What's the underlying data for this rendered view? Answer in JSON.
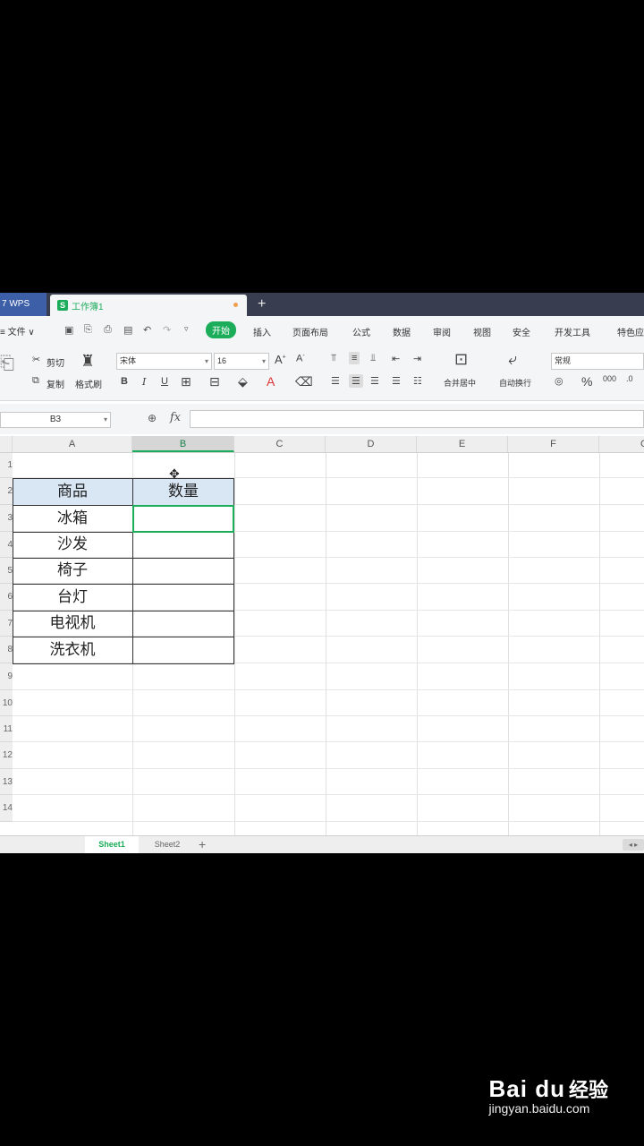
{
  "titlebar": {
    "app_tab": "7 WPS",
    "doc_tab": "工作簿1",
    "add_tab": "+"
  },
  "menubar": {
    "file": "≡ 文件 ∨",
    "items": [
      "开始",
      "插入",
      "页面布局",
      "公式",
      "数据",
      "审阅",
      "视图",
      "安全",
      "开发工具",
      "特色应"
    ],
    "active": "开始"
  },
  "ribbon": {
    "cut": "剪切",
    "copy": "复制",
    "format_painter": "格式刷",
    "font_name": "宋体",
    "font_size": "16",
    "bold": "B",
    "italic": "I",
    "underline": "U",
    "merge_center": "合并居中",
    "auto_wrap": "自动换行",
    "number_format": "常规",
    "percent": "%"
  },
  "formulabar": {
    "cell_ref": "B3",
    "fx": "fx",
    "value": ""
  },
  "columns": [
    "A",
    "B",
    "C",
    "D",
    "E",
    "F",
    "G"
  ],
  "rows": [
    "1",
    "2",
    "3",
    "4",
    "5",
    "6",
    "7",
    "8",
    "9",
    "10",
    "11",
    "12",
    "13",
    "14"
  ],
  "table": {
    "headers": [
      "商品",
      "数量"
    ],
    "items": [
      "冰箱",
      "沙发",
      "椅子",
      "台灯",
      "电视机",
      "洗衣机"
    ]
  },
  "sheets": {
    "tabs": [
      "Sheet1",
      "Sheet2"
    ],
    "active": "Sheet1",
    "add": "+"
  },
  "watermark": {
    "logo": "Bai du",
    "sub": "经验",
    "url": "jingyan.baidu.com"
  },
  "colors": {
    "accent": "#1bad5a",
    "header_fill": "#d9e6f4",
    "titlebar": "#383e4f"
  }
}
